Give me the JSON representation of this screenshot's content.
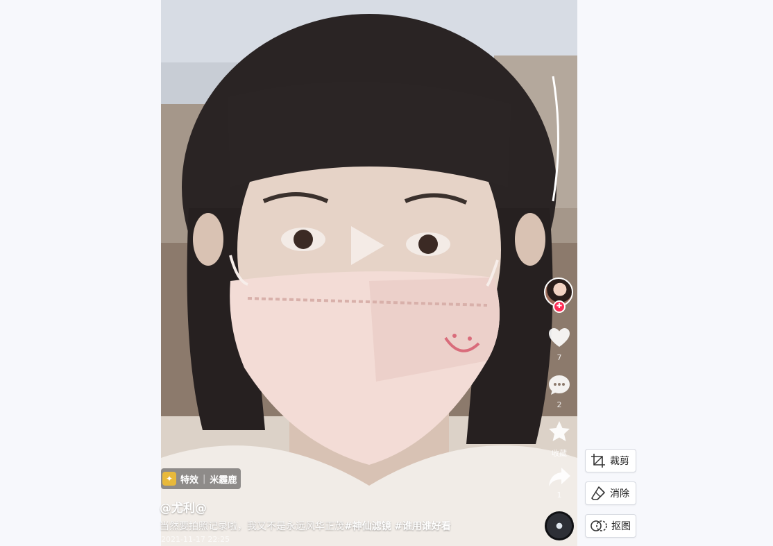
{
  "video": {
    "author": "@尤利@",
    "caption_text": "当然要拍照记录啦，我又不是永远风华正茂",
    "hashtags": [
      "#神仙滤镜",
      "#谁用谁好看"
    ],
    "timestamp": "2021-11-17 22:25",
    "effect_label": "特效",
    "effect_name": "米霾鹿"
  },
  "actions": {
    "like_count": "7",
    "comment_count": "2",
    "favorite_label": "收藏",
    "share_count": "1"
  },
  "tools": {
    "crop_label": "裁剪",
    "erase_label": "消除",
    "cutout_label": "抠图"
  },
  "colors": {
    "accent_red": "#fe2c55",
    "effect_badge": "#e8b93b"
  }
}
